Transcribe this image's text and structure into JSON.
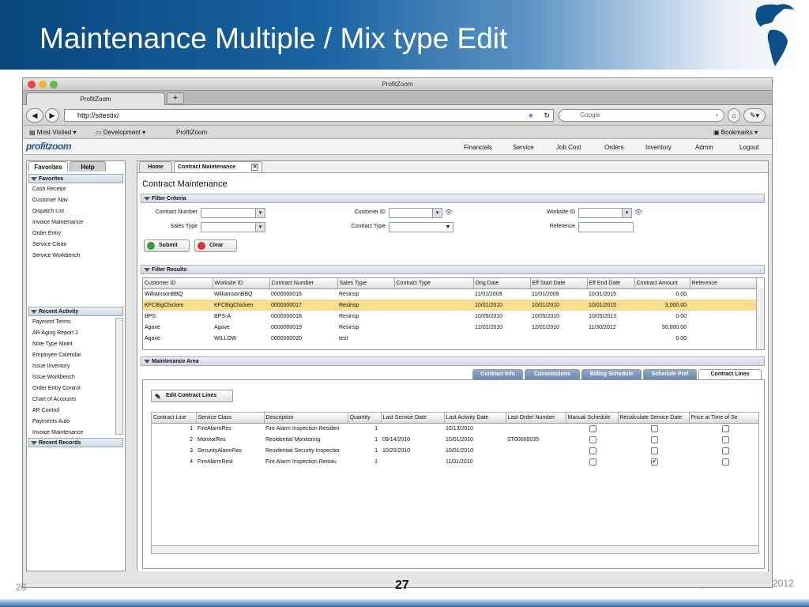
{
  "slide": {
    "title": "Maintenance Multiple / Mix type Edit",
    "page_left": "26",
    "page_center": "27",
    "year": "2012",
    "dash": "-"
  },
  "colors": {
    "header_blue": "#07477c",
    "selected_row": "#f9dd8a",
    "tab_blue": "#6b89ae"
  },
  "browser": {
    "window_title": "ProfitZoom",
    "tab_label": "ProfitZoom",
    "new_tab": "+",
    "url": "http://sitestix/",
    "search_placeholder": "Google",
    "bookmarks": {
      "most_visited": "Most Visited ▾",
      "development": "Development ▾",
      "profitzoom": "ProfitZoom",
      "bookmarks": "Bookmarks ▾"
    }
  },
  "app": {
    "logo": "profitzoom",
    "menu": [
      "Financials",
      "Service",
      "Job Cost",
      "Orders",
      "Inventory",
      "Admin",
      "Logout"
    ]
  },
  "left": {
    "tabs": [
      "Favorites",
      "Help"
    ],
    "favorites_title": "Favorites",
    "favorites": [
      "Cash Receipt",
      "Customer Nav",
      "Dispatch List",
      "Invoice Maintenance",
      "Order Entry",
      "Service Clean",
      "Service Workbench"
    ],
    "recent_activity_title": "Recent Activity",
    "recent_activity": [
      "Payment Terms",
      "AR Aging Report 2",
      "Note Type Maint",
      "Employee Calendar",
      "Issue Inventory",
      "Issue Workbench",
      "Order Entry Control",
      "Chart of Accounts",
      "AR Control",
      "Payments Auto",
      "Invoice Maintenance"
    ],
    "recent_records_title": "Recent Records"
  },
  "main": {
    "tabs": [
      "Home",
      "Contract Maintenance"
    ],
    "heading": "Contract Maintenance",
    "filter_criteria_title": "Filter Criteria",
    "filters": {
      "contract_number": "Contract Number",
      "sales_type": "Sales Type",
      "customer_id": "Customer ID",
      "contract_type": "Contract Type",
      "worksite_id": "Worksite ID",
      "reference": "Reference"
    },
    "submit": "Submit",
    "clear": "Clear",
    "filter_results_title": "Filter Results",
    "results_headers": [
      "Customer ID",
      "Worksite ID",
      "Contract Number",
      "Sales Type",
      "Contract Type",
      "Orig Date",
      "Eff Start Date",
      "Eff End Date",
      "Contract Amount",
      "Reference"
    ],
    "results_rows": [
      {
        "cust": "WilliamsonBBQ",
        "site": "WilliamsonBBQ",
        "num": "0000000016",
        "sales": "Resinsp",
        "ctype": "",
        "orig": "11/01/2009",
        "start": "11/01/2009",
        "end": "10/31/2015",
        "amt": "0.00",
        "ref": "",
        "sel": false
      },
      {
        "cust": "KFCBigChicken",
        "site": "KFCBigChicken",
        "num": "0000000017",
        "sales": "Resinsp",
        "ctype": "",
        "orig": "10/01/2010",
        "start": "10/01/2010",
        "end": "10/01/2015",
        "amt": "3,000.00",
        "ref": "",
        "sel": true
      },
      {
        "cust": "BPS",
        "site": "BPS-A",
        "num": "0000000018",
        "sales": "Resinsp",
        "ctype": "",
        "orig": "10/05/2010",
        "start": "10/05/2010",
        "end": "10/05/2013",
        "amt": "0.00",
        "ref": "",
        "sel": false
      },
      {
        "cust": "Agave",
        "site": "Agave",
        "num": "0000000019",
        "sales": "Resinsp",
        "ctype": "",
        "orig": "12/01/2010",
        "start": "12/01/2010",
        "end": "11/30/2012",
        "amt": "50,000.00",
        "ref": "",
        "sel": false
      },
      {
        "cust": "Agave",
        "site": "WILLOW",
        "num": "0000000020",
        "sales": "test",
        "ctype": "",
        "orig": "",
        "start": "",
        "end": "",
        "amt": "0.00",
        "ref": "",
        "sel": false
      }
    ],
    "maintenance_area_title": "Maintenance Area",
    "sub_tabs": [
      "Contract Info",
      "Commissions",
      "Billing Schedule",
      "Schedule Pref",
      "Contract Lines"
    ],
    "edit_lines_button": "Edit Contract Lines",
    "lines_headers": [
      "Contract Line",
      "Service Class",
      "Description",
      "Quantity",
      "Last Service Date",
      "Last Activity Date",
      "Last Order Number",
      "Manual Schedule",
      "Recalculate Service Date",
      "Price at Time of Se"
    ],
    "lines_rows": [
      {
        "line": "1",
        "cls": "FireAlarmRes",
        "desc": "Fire Alarm Inspection Residen",
        "qty": "1",
        "lsd": "",
        "lad": "10/13/2010",
        "lon": "",
        "manual": "",
        "recalc": "",
        "price": ""
      },
      {
        "line": "2",
        "cls": "MonitorRes",
        "desc": "Residential Monitoring",
        "qty": "1",
        "lsd": "09/14/2010",
        "lad": "10/01/2010",
        "lon": "ST00000035",
        "manual": "",
        "recalc": "",
        "price": ""
      },
      {
        "line": "3",
        "cls": "SecurityAlarmRes",
        "desc": "Residential Security Inspectior",
        "qty": "1",
        "lsd": "10/20/2010",
        "lad": "10/01/2010",
        "lon": "",
        "manual": "",
        "recalc": "",
        "price": ""
      },
      {
        "line": "4",
        "cls": "FireAlarmRest",
        "desc": "Fire Alarm Inspection Restau",
        "qty": "1",
        "lsd": "",
        "lad": "11/01/2010",
        "lon": "",
        "manual": "",
        "recalc": "✔",
        "price": ""
      }
    ]
  }
}
